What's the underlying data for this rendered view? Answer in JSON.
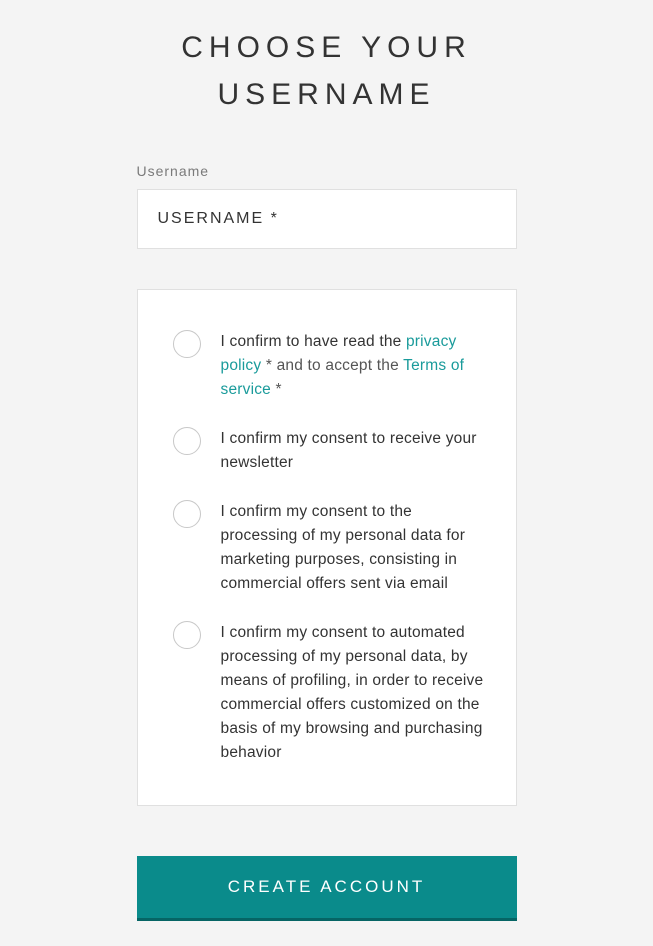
{
  "title": "CHOOSE YOUR USERNAME",
  "field": {
    "label": "Username",
    "placeholder": "USERNAME *"
  },
  "consents": {
    "privacy": {
      "prefix": "I confirm to have read the ",
      "link1": "privacy policy ",
      "mid": "* and to accept the ",
      "link2": "Terms of service ",
      "suffix": "*"
    },
    "newsletter": "I confirm my consent to receive your newsletter",
    "marketing": "I confirm my consent to the processing of my personal data for marketing purposes, consisting in commercial offers sent via email",
    "profiling": "I confirm my consent to automated processing of my personal data, by means of profiling, in order to receive commercial offers customized on the basis of my browsing and purchasing behavior"
  },
  "submit_label": "CREATE ACCOUNT"
}
